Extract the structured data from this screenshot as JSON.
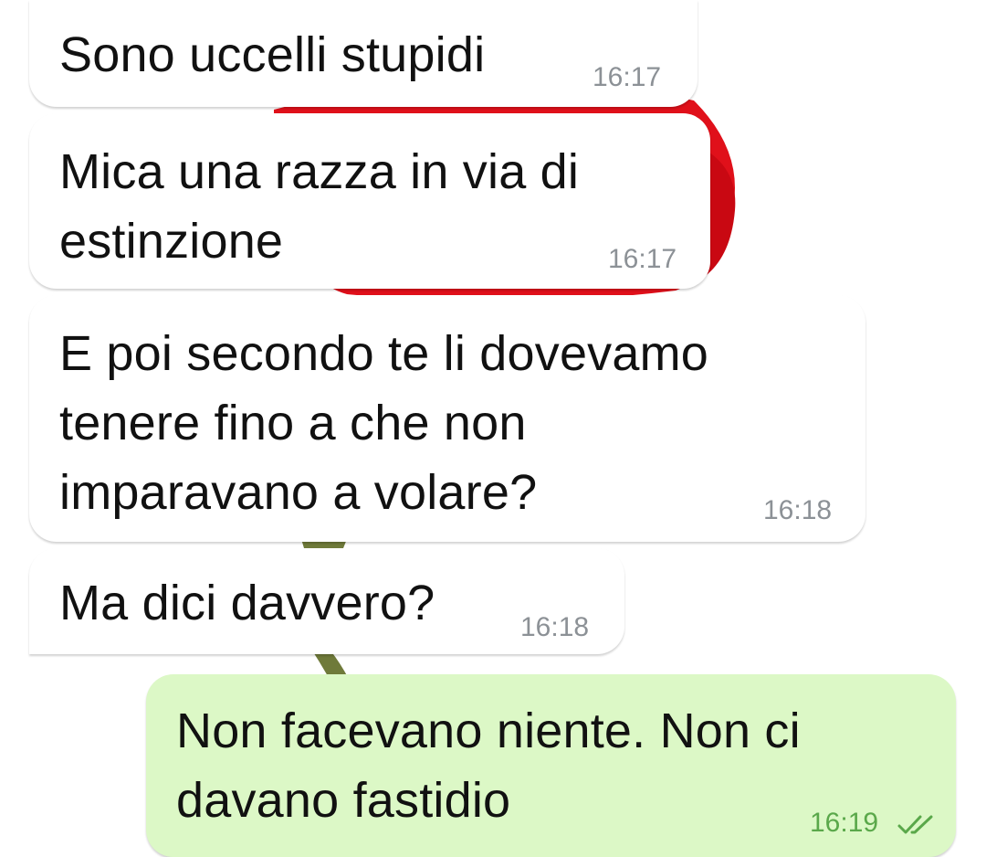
{
  "conversation": {
    "messages": [
      {
        "direction": "incoming",
        "text": "Sono uccelli stupidi",
        "time": "16:17"
      },
      {
        "direction": "incoming",
        "text": "Mica una razza in via di\nestinzione",
        "time": "16:17"
      },
      {
        "direction": "incoming",
        "text": "E poi secondo te li dovevamo\ntenere fino a che non\nimparavano a volare?",
        "time": "16:18"
      },
      {
        "direction": "incoming",
        "text": "Ma dici davvero?",
        "time": "16:18"
      },
      {
        "direction": "outgoing",
        "text": "Non facevano niente. Non ci\ndavano fastidio",
        "time": "16:19",
        "status_icon": "double-check-read-icon"
      }
    ]
  },
  "colors": {
    "incoming_bubble": "#ffffff",
    "outgoing_bubble": "#dcf8c6",
    "text": "#111111",
    "timestamp": "#8c9196",
    "outgoing_timestamp": "#5aa84a",
    "wallpaper_flower": "#e0101a",
    "wallpaper_stem": "#6f7a3a"
  }
}
